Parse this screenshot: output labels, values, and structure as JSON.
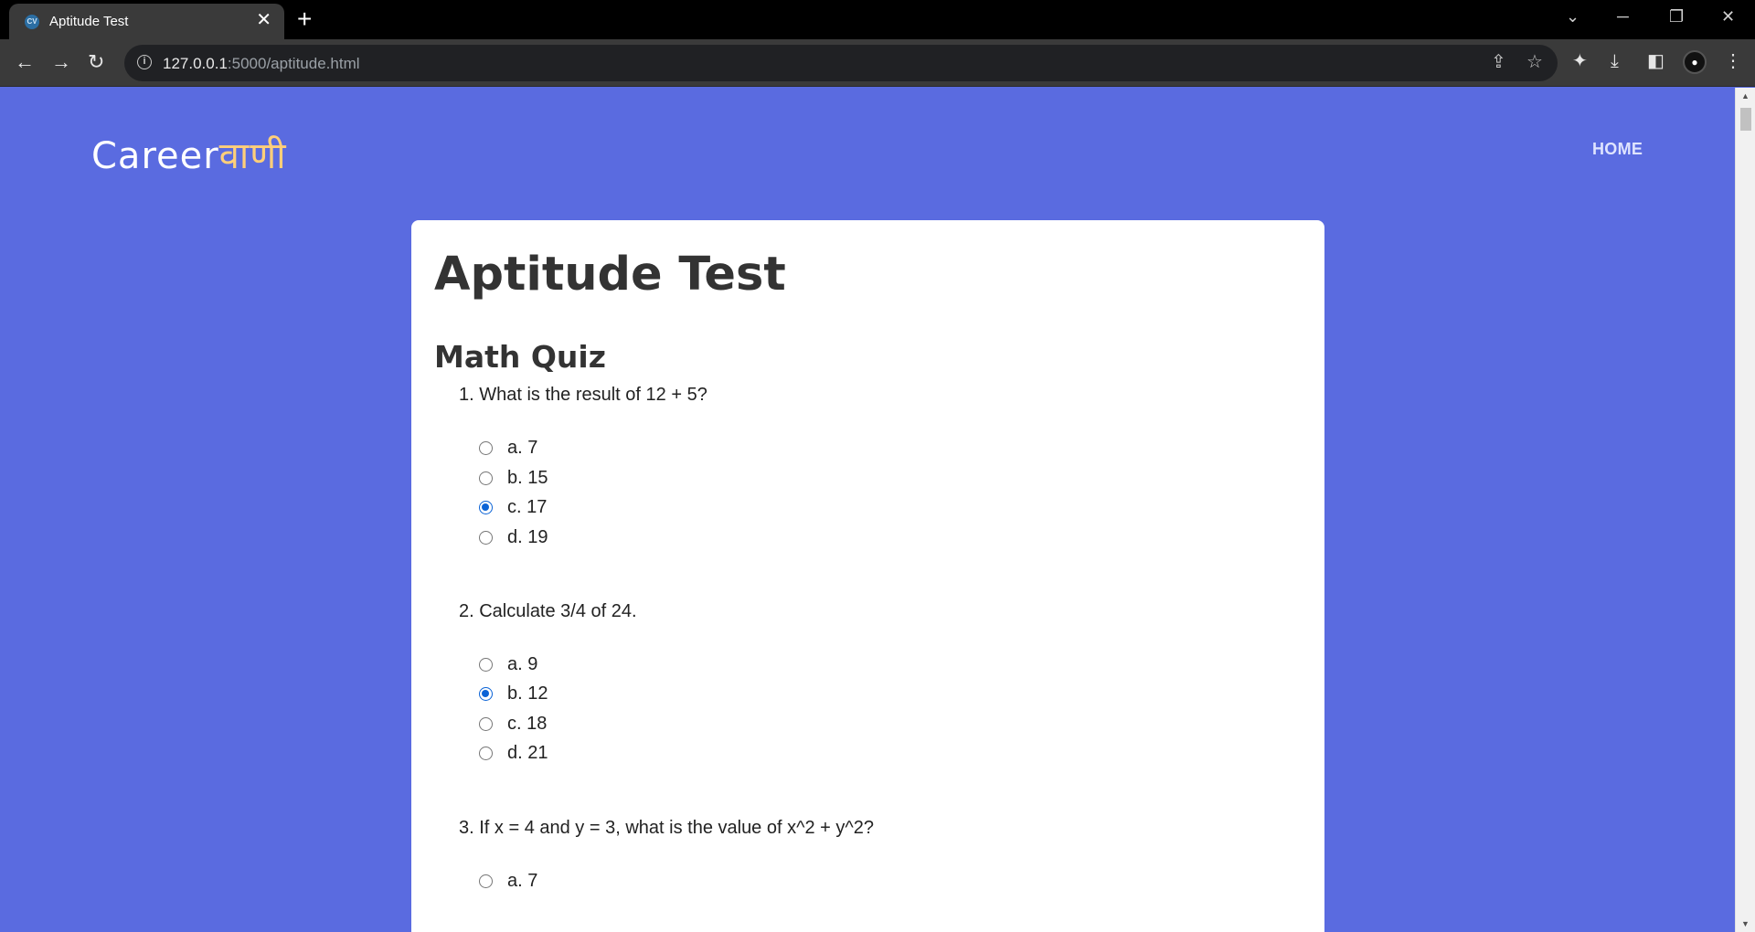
{
  "browser": {
    "tab_title": "Aptitude Test",
    "tab_favicon_text": "CV",
    "url_host": "127.0.0.1",
    "url_rest": ":5000/aptitude.html",
    "icons": {
      "back": "arrow-left-icon",
      "forward": "arrow-right-icon",
      "reload": "reload-icon",
      "info": "info-icon",
      "share": "share-icon",
      "bookmark": "star-icon",
      "extensions": "puzzle-icon",
      "download": "download-icon",
      "sidepanel": "side-panel-icon",
      "menu": "kebab-menu-icon"
    }
  },
  "site": {
    "logo_latin": "Career",
    "logo_devanagari": "वाणी",
    "nav_home": "HOME",
    "accent_color": "#ffcf7a",
    "background_color": "#5a6be0"
  },
  "main": {
    "title": "Aptitude Test",
    "section_title": "Math Quiz",
    "questions": [
      {
        "text": "1. What is the result of 12 + 5?",
        "options": [
          "a. 7",
          "b. 15",
          "c. 17",
          "d. 19"
        ],
        "selected": 2
      },
      {
        "text": "2. Calculate 3/4 of 24.",
        "options": [
          "a. 9",
          "b. 12",
          "c. 18",
          "d. 21"
        ],
        "selected": 1
      },
      {
        "text": "3. If x = 4 and y = 3, what is the value of x^2 + y^2?",
        "options": [
          "a. 7"
        ],
        "selected": null
      }
    ]
  }
}
